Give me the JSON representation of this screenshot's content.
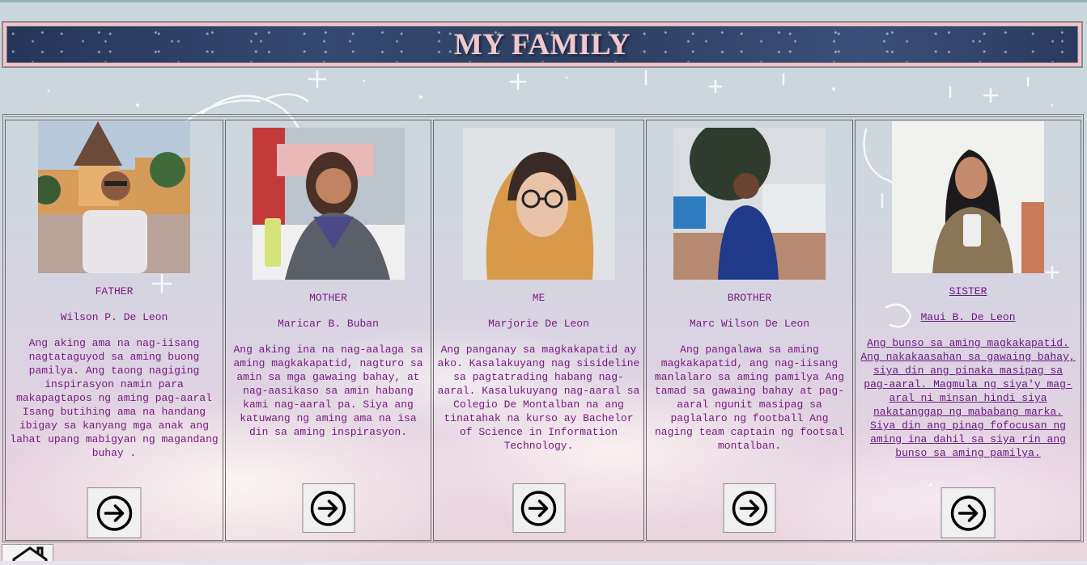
{
  "header": {
    "title": "MY FAMILY"
  },
  "members": [
    {
      "role": "FATHER",
      "name": "Wilson P. De Leon",
      "bio": "Ang aking ama na nag-iisang nagtataguyod sa aming buong pamilya. Ang taong nagiging inspirasyon namin para makapagtapos ng aming pag-aaral Isang butihing ama na handang ibigay sa kanyang mga anak ang lahat upang mabigyan ng magandang buhay ."
    },
    {
      "role": "MOTHER",
      "name": "Maricar B. Buban",
      "bio": "Ang aking ina na nag-aalaga sa aming magkakapatid, nagturo sa amin sa mga gawaing bahay, at nag-aasikaso sa amin habang kami nag-aaral pa. Siya ang katuwang ng aming ama na isa din sa aming inspirasyon."
    },
    {
      "role": "ME",
      "name": "Marjorie De Leon",
      "bio": "Ang panganay sa magkakapatid ay ako. Kasalakuyang nag sisideline sa pagtatrading habang nag-aaral. Kasalukuyang nag-aaral sa Colegio De Montalban na ang tinatahak na kurso ay Bachelor of Science in Information Technology."
    },
    {
      "role": "BROTHER",
      "name": "Marc Wilson De Leon",
      "bio": "Ang pangalawa sa aming magkakapatid, ang nag-iisang manlalaro sa aming pamilya Ang tamad sa gawaing bahay at pag-aaral ngunit masipag sa paglalaro ng football Ang naging team captain ng footsal montalban."
    },
    {
      "role": "SISTER",
      "name": "Maui B. De Leon",
      "bio": "Ang bunso sa aming magkakapatid. Ang nakakaasahan sa gawaing bahay, siya din ang pinaka masipag sa pag-aaral. Magmula ng siya'y mag-aral ni minsan hindi siya nakatanggap ng mababang marka. Siya din ang pinag fofocusan ng aming ina dahil sa siya rin ang bunso sa aming pamilya."
    }
  ],
  "icons": {
    "next": "circle-arrow-right-icon",
    "home": "home-icon"
  },
  "colors": {
    "text": "#7a1a82",
    "banner_title": "#f2c7cd",
    "banner_border": "#f4c2cc"
  }
}
